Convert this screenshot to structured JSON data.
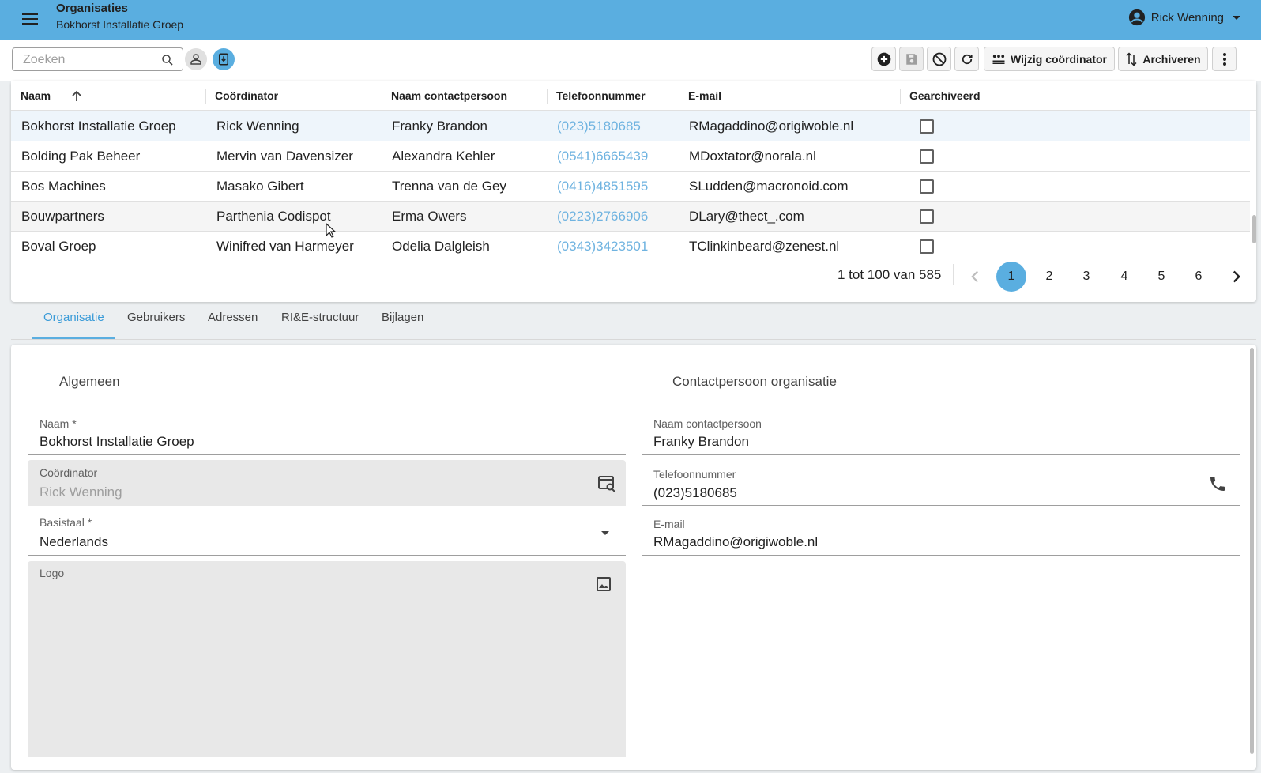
{
  "header": {
    "title": "Organisaties",
    "subtitle": "Bokhorst Installatie Groep",
    "user": "Rick Wenning"
  },
  "toolbar": {
    "search_placeholder": "Zoeken",
    "wijzig_label": "Wijzig coördinator",
    "archiveren_label": "Archiveren"
  },
  "table": {
    "columns": [
      "Naam",
      "Coördinator",
      "Naam contactpersoon",
      "Telefoonnummer",
      "E-mail",
      "Gearchiveerd"
    ],
    "rows": [
      {
        "naam": "Bokhorst Installatie Groep",
        "coordinator": "Rick Wenning",
        "contact": "Franky Brandon",
        "telefoon": "(023)5180685",
        "email": "RMagaddino@origiwoble.nl",
        "gearchiveerd": false
      },
      {
        "naam": "Bolding Pak Beheer",
        "coordinator": "Mervin van Davensizer",
        "contact": "Alexandra Kehler",
        "telefoon": "(0541)6665439",
        "email": "MDoxtator@norala.nl",
        "gearchiveerd": false
      },
      {
        "naam": "Bos Machines",
        "coordinator": "Masako Gibert",
        "contact": "Trenna van de Gey",
        "telefoon": "(0416)4851595",
        "email": "SLudden@macronoid.com",
        "gearchiveerd": false
      },
      {
        "naam": "Bouwpartners",
        "coordinator": "Parthenia Codispot",
        "contact": "Erma Owers",
        "telefoon": "(0223)2766906",
        "email": "DLary@thect_.com",
        "gearchiveerd": false
      },
      {
        "naam": "Boval Groep",
        "coordinator": "Winifred van Harmeyer",
        "contact": "Odelia Dalgleish",
        "telefoon": "(0343)3423501",
        "email": "TClinkinbeard@zenest.nl",
        "gearchiveerd": false
      }
    ]
  },
  "pagination": {
    "range": "1 tot 100 van 585",
    "pages": [
      "1",
      "2",
      "3",
      "4",
      "5",
      "6"
    ],
    "active_page": "1"
  },
  "tabs": [
    "Organisatie",
    "Gebruikers",
    "Adressen",
    "RI&E-structuur",
    "Bijlagen"
  ],
  "form": {
    "section_left": "Algemeen",
    "section_right": "Contactpersoon organisatie",
    "naam_label": "Naam *",
    "naam_value": "Bokhorst Installatie Groep",
    "coordinator_label": "Coördinator",
    "coordinator_value": "Rick Wenning",
    "basistaal_label": "Basistaal *",
    "basistaal_value": "Nederlands",
    "logo_label": "Logo",
    "contact_label": "Naam contactpersoon",
    "contact_value": "Franky Brandon",
    "telefoon_label": "Telefoonnummer",
    "telefoon_value": "(023)5180685",
    "email_label": "E-mail",
    "email_value": "RMagaddino@origiwoble.nl"
  },
  "colors": {
    "accent": "#5aaee0",
    "phone_link": "#6fb3e0",
    "selected_row": "#eef5fb"
  }
}
